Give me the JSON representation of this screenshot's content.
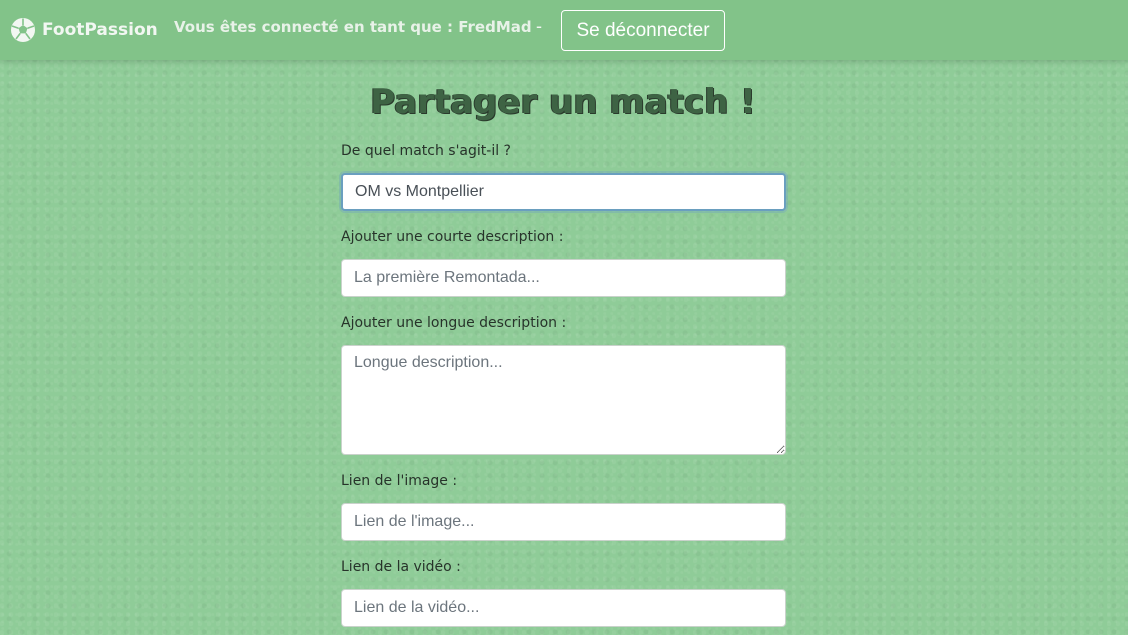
{
  "navbar": {
    "brand": "FootPassion",
    "brand_icon": "soccer-ball-icon",
    "user_status": "Vous êtes connecté en tant que : FredMad",
    "separator": "-",
    "logout_label": "Se déconnecter"
  },
  "page": {
    "title": "Partager un match !"
  },
  "form": {
    "match": {
      "label": "De quel match s'agit-il ?",
      "value": "OM vs Montpellier"
    },
    "short_description": {
      "label": "Ajouter une courte description :",
      "placeholder": "La première Remontada..."
    },
    "long_description": {
      "label": "Ajouter une longue description :",
      "placeholder": "Longue description..."
    },
    "image_link": {
      "label": "Lien de l'image :",
      "placeholder": "Lien de l'image..."
    },
    "video_link": {
      "label": "Lien de la vidéo :",
      "placeholder": "Lien de la vidéo..."
    }
  },
  "colors": {
    "navbar": "#82c389",
    "background": "#8fcc98",
    "title": "#3e6344",
    "focus_border": "#6a9fbf"
  }
}
